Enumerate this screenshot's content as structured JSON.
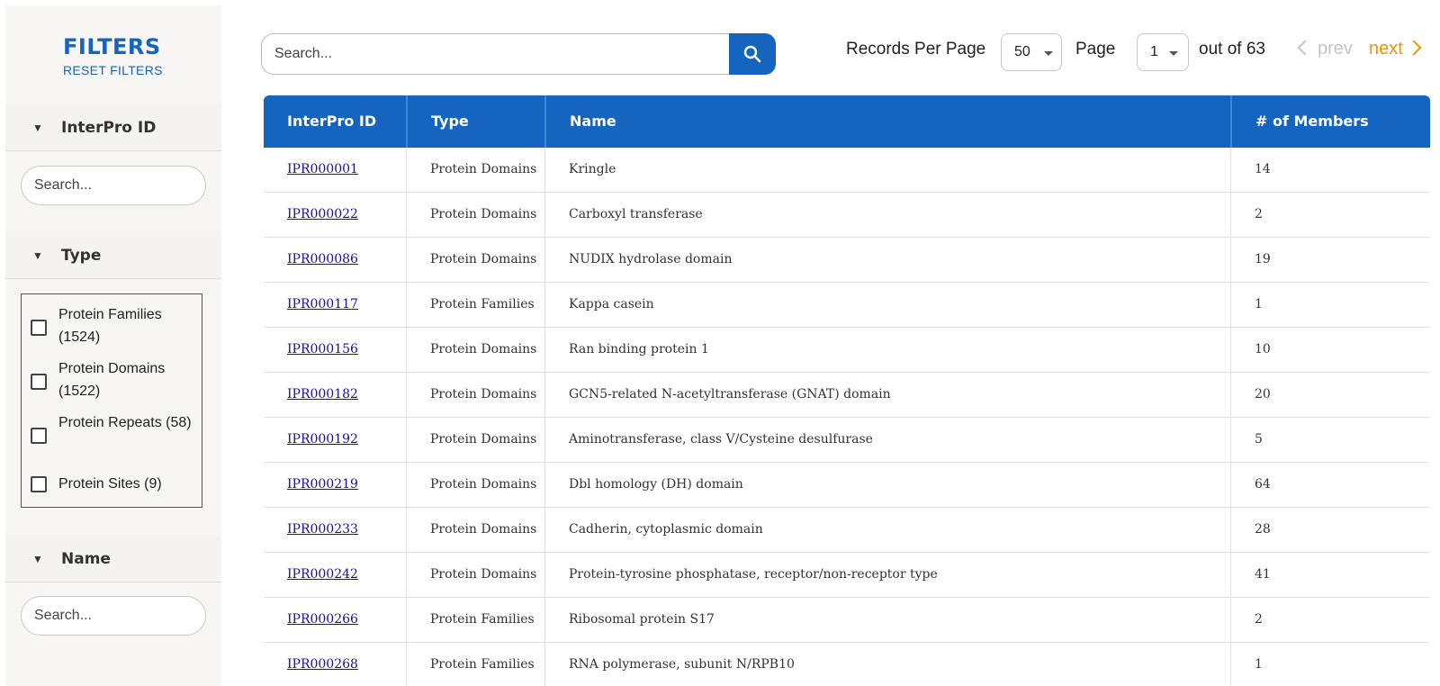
{
  "sidebar": {
    "title": "FILTERS",
    "reset_label": "RESET FILTERS",
    "sections": {
      "interpro_id": {
        "label": "InterPro ID",
        "placeholder": "Search..."
      },
      "type": {
        "label": "Type",
        "options": [
          {
            "label": "Protein Families (1524)",
            "checked": false
          },
          {
            "label": "Protein Domains (1522)",
            "checked": false
          },
          {
            "label": "Protein Repeats (58)",
            "checked": false
          },
          {
            "label": "Protein Sites (9)",
            "checked": false
          }
        ]
      },
      "name": {
        "label": "Name",
        "placeholder": "Search..."
      }
    },
    "triangle": "▼"
  },
  "toolbar": {
    "search_placeholder": "Search...",
    "search_icon": "search-icon",
    "records_per_page_label": "Records Per Page",
    "records_per_page_value": "50",
    "page_label": "Page",
    "page_value": "1",
    "out_of_label": "out of 63",
    "prev_label": "prev",
    "next_label": "next"
  },
  "table": {
    "columns": [
      "InterPro ID",
      "Type",
      "Name",
      "# of Members"
    ],
    "rows": [
      [
        "IPR000001",
        "Protein Domains",
        "Kringle",
        "14"
      ],
      [
        "IPR000022",
        "Protein Domains",
        "Carboxyl transferase",
        "2"
      ],
      [
        "IPR000086",
        "Protein Domains",
        "NUDIX hydrolase domain",
        "19"
      ],
      [
        "IPR000117",
        "Protein Families",
        "Kappa casein",
        "1"
      ],
      [
        "IPR000156",
        "Protein Domains",
        "Ran binding protein 1",
        "10"
      ],
      [
        "IPR000182",
        "Protein Domains",
        "GCN5-related N-acetyltransferase (GNAT) domain",
        "20"
      ],
      [
        "IPR000192",
        "Protein Domains",
        "Aminotransferase, class V/Cysteine desulfurase",
        "5"
      ],
      [
        "IPR000219",
        "Protein Domains",
        "Dbl homology (DH) domain",
        "64"
      ],
      [
        "IPR000233",
        "Protein Domains",
        "Cadherin, cytoplasmic domain",
        "28"
      ],
      [
        "IPR000242",
        "Protein Domains",
        "Protein-tyrosine phosphatase, receptor/non-receptor type",
        "41"
      ],
      [
        "IPR000266",
        "Protein Families",
        "Ribosomal protein S17",
        "2"
      ],
      [
        "IPR000268",
        "Protein Families",
        "RNA polymerase, subunit N/RPB10",
        "1"
      ]
    ]
  },
  "colors": {
    "accent": "#1565c0",
    "next": "#f39200",
    "prev_disabled": "#c4c4c4",
    "link": "#1a0dab"
  }
}
